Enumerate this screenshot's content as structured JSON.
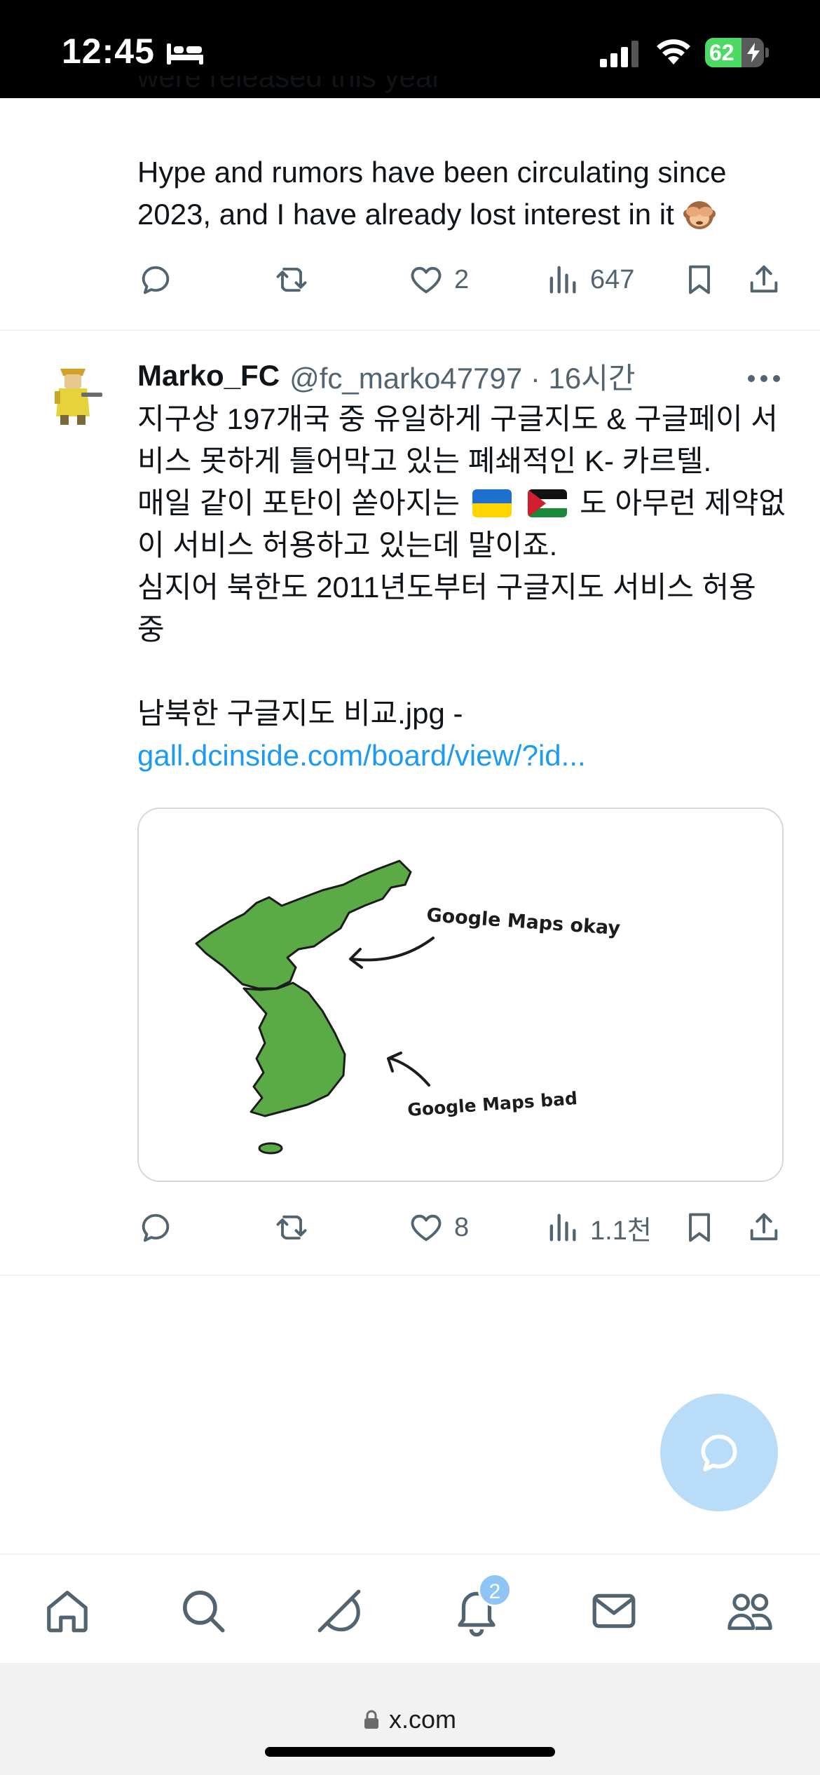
{
  "status_bar": {
    "time": "12:45",
    "battery_level": "62",
    "battery_fraction": 0.62,
    "icons": [
      "bed-icon",
      "signal-icon",
      "wifi-icon",
      "battery-icon",
      "bolt-icon"
    ]
  },
  "previous_tweet": {
    "cutoff_text": "were released this year",
    "text": "Hype and rumors have been circulating since 2023, and I have already lost interest in it",
    "likes": "2",
    "views": "647"
  },
  "tweet": {
    "display_name": "Marko_FC",
    "handle": "@fc_marko47797 · 16시간",
    "lines": [
      "지구상 197개국 중 유일하게 구글지도 & 구글페이 서",
      "비스 못하게 틀어막고 있는 폐쇄적인 K- 카르텔.",
      "매일 같이 포탄이 쏟아지는",
      "도 아무런 제약없",
      "이 서비스 허용하고 있는데 말이죠.",
      "심지어 북한도 2011년도부터 구글지도 서비스 허용",
      "중",
      "남북한 구글지도 비교.jpg -"
    ],
    "link": "gall.dcinside.com/board/view/?id...",
    "media": {
      "label_top": "Google Maps okay",
      "label_bottom": "Google Maps bad"
    },
    "likes": "8",
    "views": "1.1천"
  },
  "tab_bar": {
    "notification_count": "2",
    "tabs": [
      "home-icon",
      "search-icon",
      "grok-icon",
      "bell-icon",
      "mail-icon",
      "communities-icon"
    ]
  },
  "browser": {
    "url": "x.com"
  },
  "colors": {
    "link": "#1d9bf0",
    "muted": "#536471",
    "map_green": "#5aaa46",
    "fab": "#b9dcf8"
  }
}
